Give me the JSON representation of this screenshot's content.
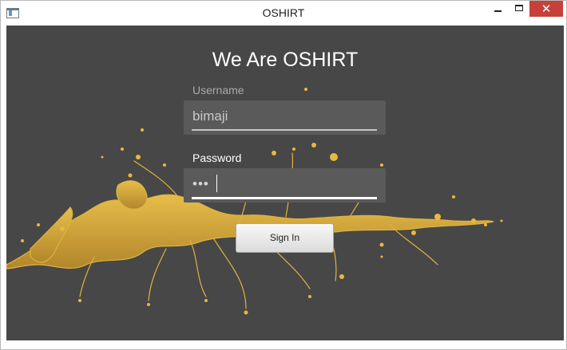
{
  "window": {
    "title": "OSHIRT",
    "app_icon": "app-window-icon",
    "controls": {
      "minimize_icon": "minimize-icon",
      "maximize_icon": "maximize-icon",
      "close_icon": "close-icon",
      "close_glyph": "✕"
    }
  },
  "login": {
    "heading": "We Are OSHIRT",
    "username_label": "Username",
    "username_value": "bimaji",
    "password_label": "Password",
    "password_mask": "•••",
    "signin_label": "Sign In"
  },
  "colors": {
    "background": "#474747",
    "field": "#5a5a5a",
    "close_button": "#c7403a",
    "splash": "#e6b53a"
  }
}
